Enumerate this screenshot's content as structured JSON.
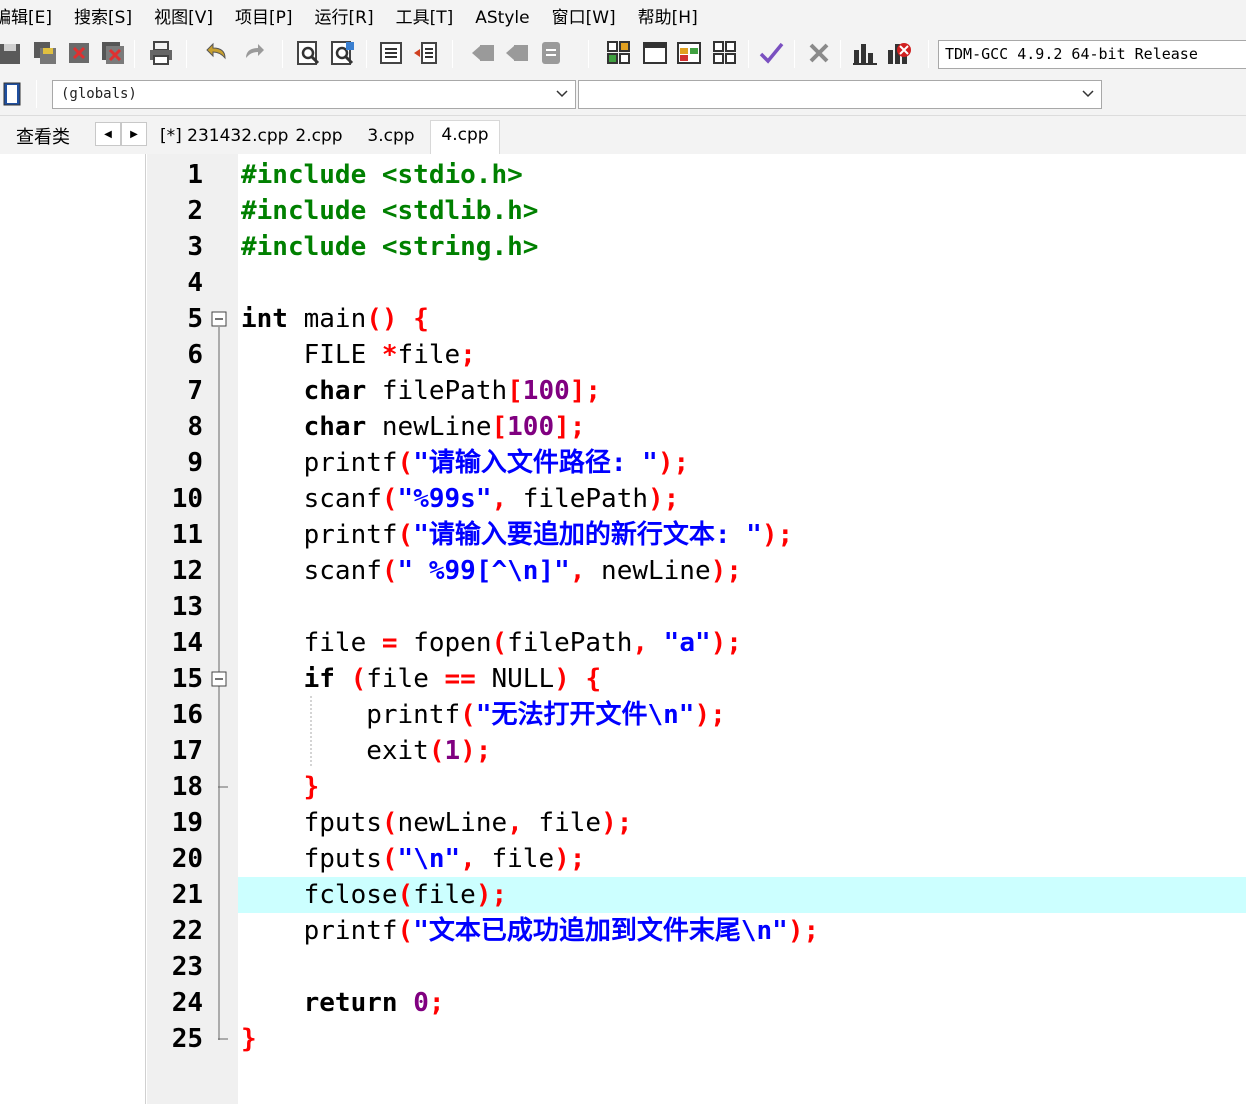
{
  "menu": [
    "编辑[E]",
    "搜索[S]",
    "视图[V]",
    "项目[P]",
    "运行[R]",
    "工具[T]",
    "AStyle",
    "窗口[W]",
    "帮助[H]"
  ],
  "toolbar": {
    "compiler": "TDM-GCC 4.9.2 64-bit Release"
  },
  "combos": {
    "globals": "(globals)",
    "function": ""
  },
  "class_tab": "查看类",
  "tabs": [
    "[*] 231432.cpp",
    "2.cpp",
    "3.cpp",
    "4.cpp"
  ],
  "active_tab": "4.cpp",
  "colors": {
    "preprocessor": "#008000",
    "operator": "#ff0000",
    "number": "#800080",
    "string": "#0000ff",
    "highlight": "#ccffff"
  },
  "lines": [
    {
      "n": "1",
      "tokens": [
        [
          "pp",
          "#include <stdio.h>"
        ]
      ]
    },
    {
      "n": "2",
      "tokens": [
        [
          "pp",
          "#include <stdlib.h>"
        ]
      ]
    },
    {
      "n": "3",
      "tokens": [
        [
          "pp",
          "#include <string.h>"
        ]
      ]
    },
    {
      "n": "4",
      "tokens": []
    },
    {
      "n": "5",
      "fold": "open",
      "tokens": [
        [
          "kw",
          "int"
        ],
        [
          "id",
          " main"
        ],
        [
          "op",
          "()"
        ],
        [
          "id",
          " "
        ],
        [
          "op",
          "{"
        ]
      ]
    },
    {
      "n": "6",
      "tokens": [
        [
          "id",
          "    FILE "
        ],
        [
          "op",
          "*"
        ],
        [
          "id",
          "file"
        ],
        [
          "op",
          ";"
        ]
      ]
    },
    {
      "n": "7",
      "tokens": [
        [
          "id",
          "    "
        ],
        [
          "kw",
          "char"
        ],
        [
          "id",
          " filePath"
        ],
        [
          "op",
          "["
        ],
        [
          "num",
          "100"
        ],
        [
          "op",
          "];"
        ]
      ]
    },
    {
      "n": "8",
      "tokens": [
        [
          "id",
          "    "
        ],
        [
          "kw",
          "char"
        ],
        [
          "id",
          " newLine"
        ],
        [
          "op",
          "["
        ],
        [
          "num",
          "100"
        ],
        [
          "op",
          "];"
        ]
      ]
    },
    {
      "n": "9",
      "tokens": [
        [
          "id",
          "    printf"
        ],
        [
          "op",
          "("
        ],
        [
          "str",
          "\"请输入文件路径: \""
        ],
        [
          "op",
          ");"
        ]
      ]
    },
    {
      "n": "10",
      "tokens": [
        [
          "id",
          "    scanf"
        ],
        [
          "op",
          "("
        ],
        [
          "str",
          "\"%99s\""
        ],
        [
          "op",
          ","
        ],
        [
          "id",
          " filePath"
        ],
        [
          "op",
          ");"
        ]
      ]
    },
    {
      "n": "11",
      "tokens": [
        [
          "id",
          "    printf"
        ],
        [
          "op",
          "("
        ],
        [
          "str",
          "\"请输入要追加的新行文本: \""
        ],
        [
          "op",
          ");"
        ]
      ]
    },
    {
      "n": "12",
      "tokens": [
        [
          "id",
          "    scanf"
        ],
        [
          "op",
          "("
        ],
        [
          "str",
          "\" %99[^\\n]\""
        ],
        [
          "op",
          ","
        ],
        [
          "id",
          " newLine"
        ],
        [
          "op",
          ");"
        ]
      ]
    },
    {
      "n": "13",
      "tokens": []
    },
    {
      "n": "14",
      "tokens": [
        [
          "id",
          "    file "
        ],
        [
          "op",
          "="
        ],
        [
          "id",
          " fopen"
        ],
        [
          "op",
          "("
        ],
        [
          "id",
          "filePath"
        ],
        [
          "op",
          ","
        ],
        [
          "id",
          " "
        ],
        [
          "str",
          "\"a\""
        ],
        [
          "op",
          ");"
        ]
      ]
    },
    {
      "n": "15",
      "fold": "open",
      "tokens": [
        [
          "id",
          "    "
        ],
        [
          "kw",
          "if"
        ],
        [
          "id",
          " "
        ],
        [
          "op",
          "("
        ],
        [
          "id",
          "file "
        ],
        [
          "op",
          "=="
        ],
        [
          "id",
          " NULL"
        ],
        [
          "op",
          ")"
        ],
        [
          "id",
          " "
        ],
        [
          "op",
          "{"
        ]
      ]
    },
    {
      "n": "16",
      "tokens": [
        [
          "id",
          "        printf"
        ],
        [
          "op",
          "("
        ],
        [
          "str",
          "\"无法打开文件\\n\""
        ],
        [
          "op",
          ");"
        ]
      ]
    },
    {
      "n": "17",
      "tokens": [
        [
          "id",
          "        exit"
        ],
        [
          "op",
          "("
        ],
        [
          "num",
          "1"
        ],
        [
          "op",
          ");"
        ]
      ]
    },
    {
      "n": "18",
      "fold": "end",
      "tokens": [
        [
          "id",
          "    "
        ],
        [
          "op",
          "}"
        ]
      ]
    },
    {
      "n": "19",
      "tokens": [
        [
          "id",
          "    fputs"
        ],
        [
          "op",
          "("
        ],
        [
          "id",
          "newLine"
        ],
        [
          "op",
          ","
        ],
        [
          "id",
          " file"
        ],
        [
          "op",
          ");"
        ]
      ]
    },
    {
      "n": "20",
      "tokens": [
        [
          "id",
          "    fputs"
        ],
        [
          "op",
          "("
        ],
        [
          "str",
          "\"\\n\""
        ],
        [
          "op",
          ","
        ],
        [
          "id",
          " file"
        ],
        [
          "op",
          ");"
        ]
      ]
    },
    {
      "n": "21",
      "highlight": true,
      "tokens": [
        [
          "id",
          "    fclose"
        ],
        [
          "op",
          "("
        ],
        [
          "id",
          "file"
        ],
        [
          "op",
          ");"
        ]
      ]
    },
    {
      "n": "22",
      "tokens": [
        [
          "id",
          "    printf"
        ],
        [
          "op",
          "("
        ],
        [
          "str",
          "\"文本已成功追加到文件末尾\\n\""
        ],
        [
          "op",
          ");"
        ]
      ]
    },
    {
      "n": "23",
      "tokens": []
    },
    {
      "n": "24",
      "tokens": [
        [
          "id",
          "    "
        ],
        [
          "kw",
          "return"
        ],
        [
          "id",
          " "
        ],
        [
          "num",
          "0"
        ],
        [
          "op",
          ";"
        ]
      ]
    },
    {
      "n": "25",
      "fold": "end",
      "tokens": [
        [
          "op",
          "}"
        ]
      ]
    }
  ]
}
